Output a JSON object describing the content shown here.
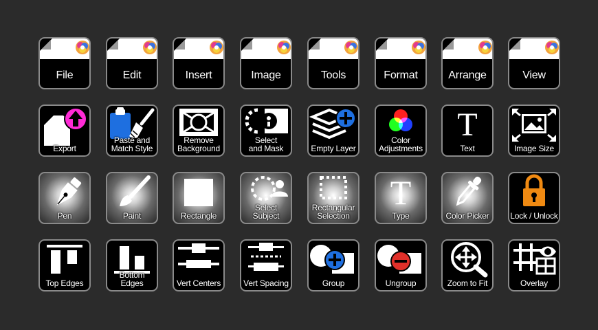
{
  "colors": {
    "background": "#2b2b2b",
    "tile": "#000000",
    "tile_border": "#8a8a8a",
    "accent_blue": "#1e6fe0",
    "accent_magenta": "#ff2bd6",
    "accent_red": "#e0302a",
    "accent_orange": "#f08a12"
  },
  "menus": [
    {
      "label": "File",
      "icon": "document-corner-icon"
    },
    {
      "label": "Edit",
      "icon": "document-corner-icon"
    },
    {
      "label": "Insert",
      "icon": "document-corner-icon"
    },
    {
      "label": "Image",
      "icon": "document-corner-icon"
    },
    {
      "label": "Tools",
      "icon": "document-corner-icon"
    },
    {
      "label": "Format",
      "icon": "document-corner-icon"
    },
    {
      "label": "Arrange",
      "icon": "document-corner-icon"
    },
    {
      "label": "View",
      "icon": "document-corner-icon"
    }
  ],
  "tools_row1": [
    {
      "label": "Export",
      "icon": "export-icon"
    },
    {
      "label": "Paste and\nMatch Style",
      "icon": "paste-match-style-icon"
    },
    {
      "label": "Remove\nBackground",
      "icon": "remove-background-icon"
    },
    {
      "label": "Select\nand Mask",
      "icon": "select-mask-icon"
    },
    {
      "label": "Empty Layer",
      "icon": "empty-layer-icon"
    },
    {
      "label": "Color\nAdjustments",
      "icon": "color-adjustments-icon"
    },
    {
      "label": "Text",
      "icon": "text-icon"
    },
    {
      "label": "Image Size",
      "icon": "image-size-icon"
    }
  ],
  "tools_row2": [
    {
      "label": "Pen",
      "icon": "pen-icon"
    },
    {
      "label": "Paint",
      "icon": "paint-brush-icon"
    },
    {
      "label": "Rectangle",
      "icon": "rectangle-icon"
    },
    {
      "label": "Select\nSubject",
      "icon": "select-subject-icon"
    },
    {
      "label": "Rectangular\nSelection",
      "icon": "rectangular-selection-icon"
    },
    {
      "label": "Type",
      "icon": "type-icon"
    },
    {
      "label": "Color Picker",
      "icon": "eyedropper-icon"
    },
    {
      "label": "Lock / Unlock",
      "icon": "lock-icon"
    }
  ],
  "tools_row3": [
    {
      "label": "Top Edges",
      "icon": "align-top-edges-icon"
    },
    {
      "label": "Bottom Edges",
      "icon": "align-bottom-edges-icon"
    },
    {
      "label": "Vert Centers",
      "icon": "align-vert-centers-icon"
    },
    {
      "label": "Vert Spacing",
      "icon": "distribute-vert-spacing-icon"
    },
    {
      "label": "Group",
      "icon": "group-icon"
    },
    {
      "label": "Ungroup",
      "icon": "ungroup-icon"
    },
    {
      "label": "Zoom to Fit",
      "icon": "zoom-to-fit-icon"
    },
    {
      "label": "Overlay",
      "icon": "overlay-icon"
    }
  ]
}
